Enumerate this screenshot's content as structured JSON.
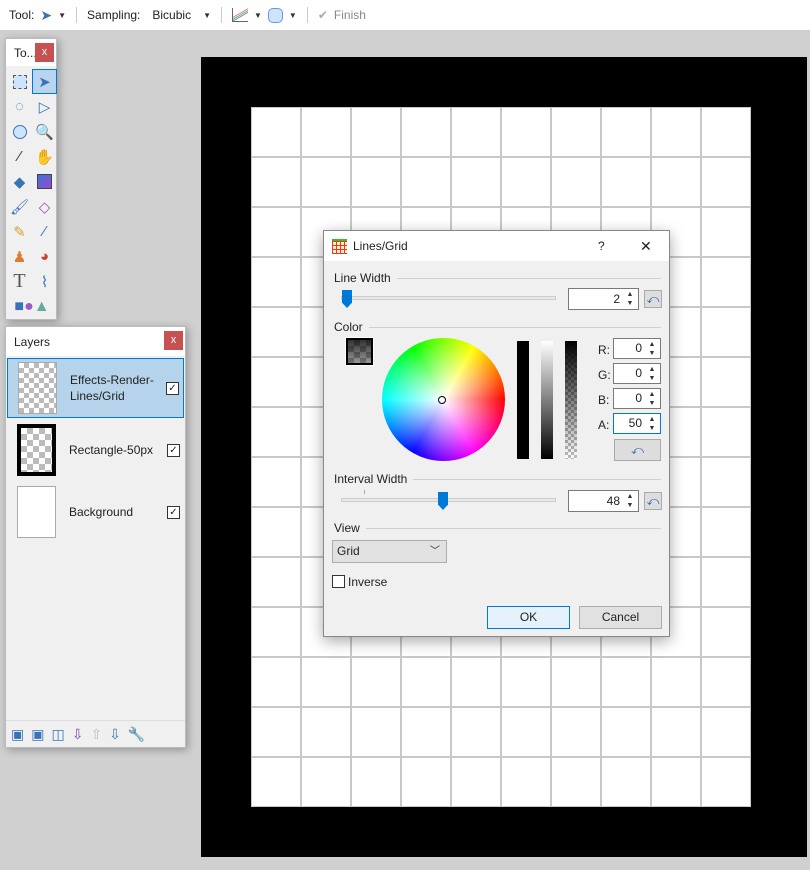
{
  "toolbar": {
    "tool_label": "Tool:",
    "sampling_label": "Sampling:",
    "sampling_value": "Bicubic",
    "finish_label": "Finish"
  },
  "tools_window": {
    "title": "To...",
    "close": "x",
    "tools": [
      "rectangle-select",
      "move-selected",
      "lasso-select",
      "move-selection",
      "ellipse-select",
      "zoom",
      "magic-wand",
      "pan",
      "paint-bucket",
      "gradient",
      "paintbrush",
      "eraser",
      "pencil",
      "color-picker",
      "clone-stamp",
      "recolor",
      "text",
      "line-curve",
      "shapes"
    ]
  },
  "layers_window": {
    "title": "Layers",
    "close": "x",
    "layers": [
      {
        "name": "Effects-Render-Lines/Grid",
        "visible": true,
        "selected": true
      },
      {
        "name": "Rectangle-50px",
        "visible": true,
        "selected": false
      },
      {
        "name": "Background",
        "visible": true,
        "selected": false
      }
    ],
    "actions": [
      "add-layer",
      "delete-layer",
      "duplicate-layer",
      "merge-layer-down",
      "move-layer-up",
      "move-layer-down",
      "layer-properties"
    ]
  },
  "dialog": {
    "title": "Lines/Grid",
    "help": "?",
    "close": "✕",
    "line_width": {
      "label": "Line Width",
      "value": "2"
    },
    "color": {
      "label": "Color",
      "r_label": "R:",
      "r": "0",
      "g_label": "G:",
      "g": "0",
      "b_label": "B:",
      "b": "0",
      "a_label": "A:",
      "a": "50"
    },
    "interval_width": {
      "label": "Interval Width",
      "value": "48"
    },
    "view": {
      "label": "View",
      "selected": "Grid"
    },
    "inverse": {
      "label": "Inverse",
      "checked": false
    },
    "ok": "OK",
    "cancel": "Cancel"
  }
}
